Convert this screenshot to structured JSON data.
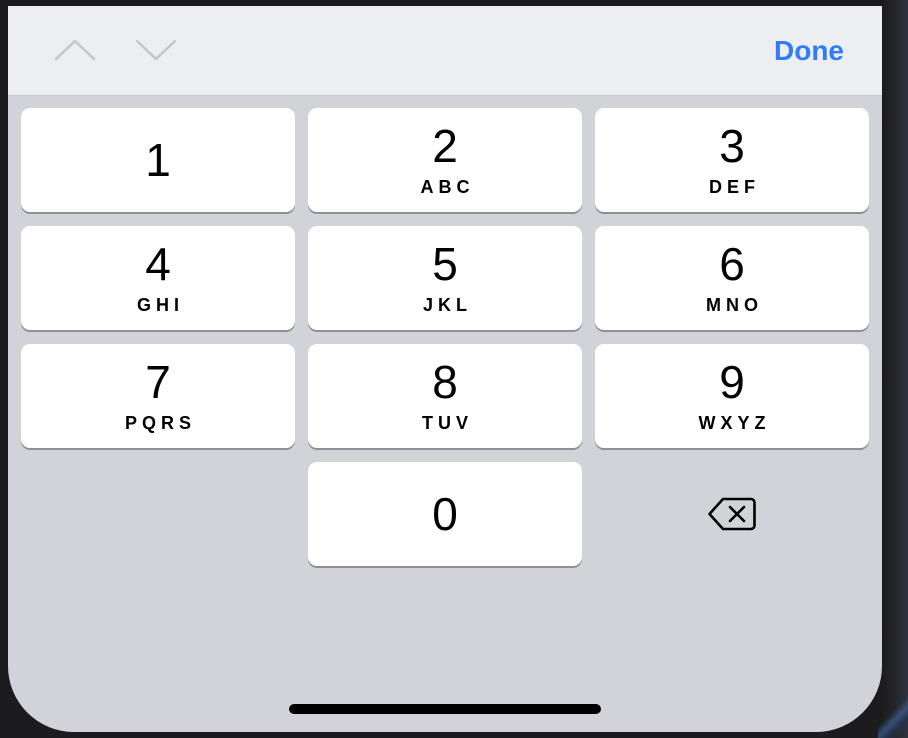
{
  "accessory_bar": {
    "previous_icon": "chevron-up-icon",
    "next_icon": "chevron-down-icon",
    "done_label": "Done",
    "accent_color": "#2f7cf6",
    "arrow_color": "#c7c8cc"
  },
  "keypad": {
    "keys": [
      {
        "digit": "1",
        "letters": ""
      },
      {
        "digit": "2",
        "letters": "ABC"
      },
      {
        "digit": "3",
        "letters": "DEF"
      },
      {
        "digit": "4",
        "letters": "GHI"
      },
      {
        "digit": "5",
        "letters": "JKL"
      },
      {
        "digit": "6",
        "letters": "MNO"
      },
      {
        "digit": "7",
        "letters": "PQRS"
      },
      {
        "digit": "8",
        "letters": "TUV"
      },
      {
        "digit": "9",
        "letters": "WXYZ"
      },
      {
        "digit": "0",
        "letters": ""
      }
    ],
    "delete_icon": "backspace-icon",
    "key_background": "#ffffff",
    "keyboard_background": "#d1d3d9"
  },
  "home_indicator": {
    "color": "#000000"
  }
}
